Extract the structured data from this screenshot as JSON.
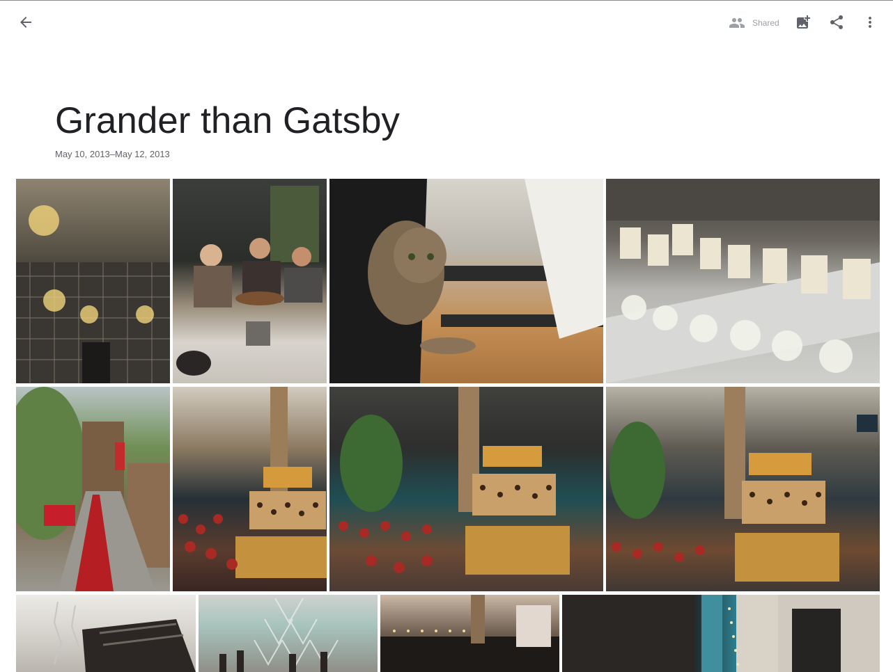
{
  "toolbar": {
    "back_icon": "arrow-back-icon",
    "shared_label": "Shared",
    "shared_icon": "people-icon",
    "add_photo_icon": "add-photo-icon",
    "share_icon": "share-icon",
    "more_icon": "more-vert-icon"
  },
  "album": {
    "title": "Grander than Gatsby",
    "date_range": "May 10, 2013–May 12, 2013"
  },
  "photos": [
    {
      "subject": "chandeliers and patterned wall"
    },
    {
      "subject": "friends with birthday cake at table"
    },
    {
      "subject": "tabby cat on office chair"
    },
    {
      "subject": "candles on wine glasses with roses"
    },
    {
      "subject": "alley with red carpet and red chair"
    },
    {
      "subject": "tiered cake with strawberry desserts"
    },
    {
      "subject": "tiered cake with strawberry desserts, wide"
    },
    {
      "subject": "tiered cake with strawberry desserts, alternate"
    },
    {
      "subject": "black box with glassware"
    },
    {
      "subject": "champagne glass tower with bottles"
    },
    {
      "subject": "room with string lights"
    },
    {
      "subject": "dark room with tiled wall and window"
    }
  ],
  "colors": {
    "background": "#ffffff",
    "icon": "#5f6368",
    "icon_muted": "#9aa0a6",
    "title": "#202124",
    "secondary_text": "#5f6368"
  }
}
